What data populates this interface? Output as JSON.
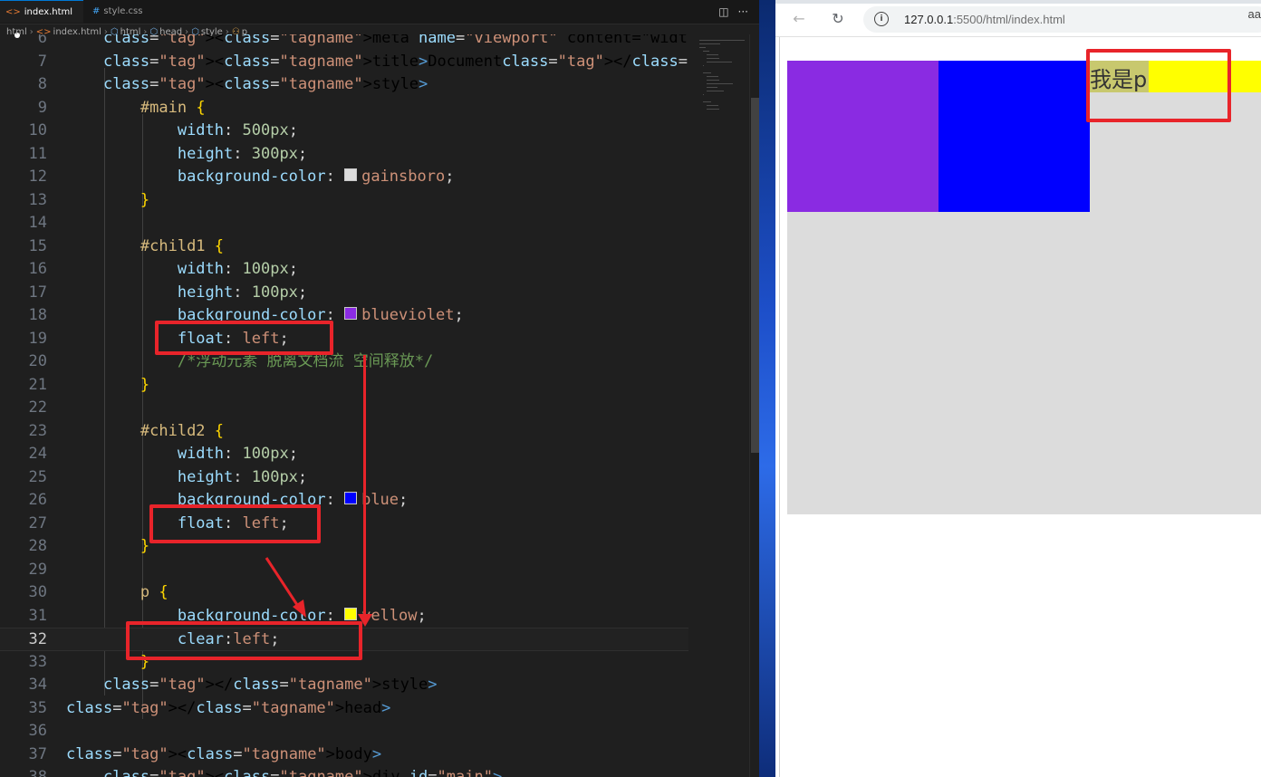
{
  "editor": {
    "tabs": [
      {
        "label": "index.html",
        "icon": "<>",
        "active": true,
        "modified": true
      },
      {
        "label": "style.css",
        "icon": "#",
        "active": false,
        "modified": false
      }
    ],
    "toolbar": {
      "split_icon": "split-editor-icon",
      "more_icon": "more-actions-icon"
    },
    "breadcrumb": [
      "html",
      "index.html",
      "html",
      "head",
      "style",
      "p"
    ],
    "current_line": 32,
    "lines": [
      {
        "n": "6",
        "text": "    <meta name=\"viewport\" content=\"width=device-width, initial-sc"
      },
      {
        "n": "7",
        "text": "    <title>Document</title>"
      },
      {
        "n": "8",
        "text": "    <style>"
      },
      {
        "n": "9",
        "text": "        #main {"
      },
      {
        "n": "10",
        "text": "            width: 500px;"
      },
      {
        "n": "11",
        "text": "            height: 300px;"
      },
      {
        "n": "12",
        "text": "            background-color: gainsboro;"
      },
      {
        "n": "13",
        "text": "        }"
      },
      {
        "n": "14",
        "text": ""
      },
      {
        "n": "15",
        "text": "        #child1 {"
      },
      {
        "n": "16",
        "text": "            width: 100px;"
      },
      {
        "n": "17",
        "text": "            height: 100px;"
      },
      {
        "n": "18",
        "text": "            background-color: blueviolet;"
      },
      {
        "n": "19",
        "text": "            float: left;"
      },
      {
        "n": "20",
        "text": "            /*浮动元素 脱离文档流 空间释放*/"
      },
      {
        "n": "21",
        "text": "        }"
      },
      {
        "n": "22",
        "text": ""
      },
      {
        "n": "23",
        "text": "        #child2 {"
      },
      {
        "n": "24",
        "text": "            width: 100px;"
      },
      {
        "n": "25",
        "text": "            height: 100px;"
      },
      {
        "n": "26",
        "text": "            background-color: blue;"
      },
      {
        "n": "27",
        "text": "            float: left;"
      },
      {
        "n": "28",
        "text": "        }"
      },
      {
        "n": "29",
        "text": ""
      },
      {
        "n": "30",
        "text": "        p {"
      },
      {
        "n": "31",
        "text": "            background-color: yellow;"
      },
      {
        "n": "32",
        "text": "            clear:left;"
      },
      {
        "n": "33",
        "text": "        }"
      },
      {
        "n": "34",
        "text": "    </style>"
      },
      {
        "n": "35",
        "text": "</head>"
      },
      {
        "n": "36",
        "text": ""
      },
      {
        "n": "37",
        "text": "<body>"
      },
      {
        "n": "38",
        "text": "    <div id=\"main\">"
      }
    ],
    "colors": {
      "gainsboro": "#dcdcdc",
      "blueviolet": "#8a2be2",
      "blue": "#0000ff",
      "yellow": "#ffff00"
    }
  },
  "browser": {
    "url_host": "127.0.0.1",
    "url_rest": ":5500/html/index.html",
    "corner_text": "aa",
    "page": {
      "p_text": "我是p",
      "colors": {
        "main": "#dcdcdc",
        "child1": "#8a2be2",
        "child2": "#0000ff",
        "p": "#ffff00"
      }
    }
  },
  "annotation_color": "#e8242a"
}
